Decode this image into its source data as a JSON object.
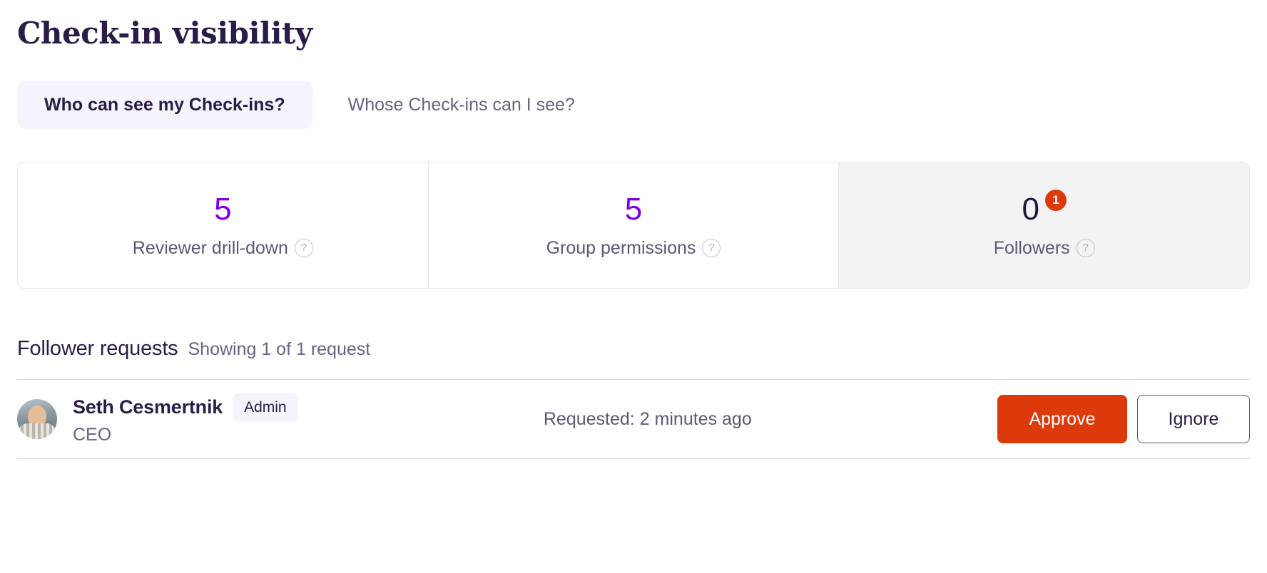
{
  "header": {
    "title": "Check-in visibility"
  },
  "tabs": [
    {
      "label": "Who can see my Check-ins?",
      "active": true
    },
    {
      "label": "Whose Check-ins can I see?",
      "active": false
    }
  ],
  "stat_cards": [
    {
      "value": "5",
      "label": "Reviewer drill-down",
      "help_icon": "?",
      "selected": false,
      "value_color": "#8000E6"
    },
    {
      "value": "5",
      "label": "Group permissions",
      "help_icon": "?",
      "selected": false,
      "value_color": "#8000E6"
    },
    {
      "value": "0",
      "label": "Followers",
      "help_icon": "?",
      "selected": true,
      "badge": "1",
      "badge_color": "#DC3A0A",
      "value_color": "#241642"
    }
  ],
  "requests": {
    "title": "Follower requests",
    "subtitle": "Showing 1 of 1 request",
    "rows": [
      {
        "name": "Seth Cesmertnik",
        "role_badge": "Admin",
        "subtitle": "CEO",
        "meta": "Requested: 2 minutes ago",
        "approve_label": "Approve",
        "ignore_label": "Ignore"
      }
    ]
  },
  "colors": {
    "brand_purple": "#8000E6",
    "navy": "#2A1B48",
    "accent_orange": "#DC3A0A",
    "tab_active_bg": "#F5F3FB",
    "card_border": "#E3EAE8",
    "card_selected_bg": "#F3F3F3"
  }
}
